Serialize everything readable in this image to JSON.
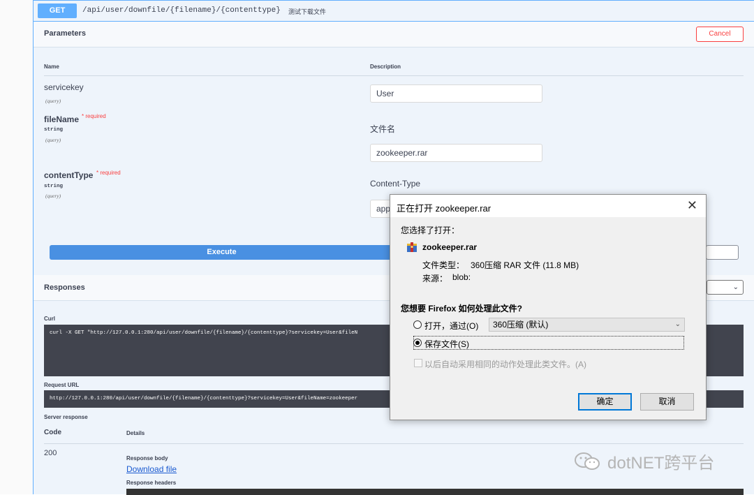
{
  "operation": {
    "method": "GET",
    "path": "/api/user/downfile/{filename}/{contenttype}",
    "summary": "测试下载文件"
  },
  "parameters": {
    "title": "Parameters",
    "cancel_label": "Cancel",
    "col_name": "Name",
    "col_description": "Description",
    "items": [
      {
        "name": "servicekey",
        "required": "",
        "type": "",
        "in": "(query)",
        "description": "",
        "value": "User"
      },
      {
        "name": "fileName",
        "required": "* required",
        "type": "string",
        "in": "(query)",
        "description": "文件名",
        "value": "zookeeper.rar"
      },
      {
        "name": "contentType",
        "required": "* required",
        "type": "string",
        "in": "(query)",
        "description": "Content-Type",
        "value": "app"
      }
    ],
    "execute_label": "Execute"
  },
  "responses": {
    "title": "Responses",
    "select_value": "⌄",
    "curl_label": "Curl",
    "curl_value": "curl -X GET \"http://127.0.0.1:280/api/user/downfile/{filename}/{contenttype}?servicekey=User&fileN",
    "request_url_label": "Request URL",
    "request_url_value": "http://127.0.0.1:280/api/user/downfile/{filename}/{contenttype}?servicekey=User&fileName=zookeeper",
    "server_response_label": "Server response",
    "col_code": "Code",
    "col_details": "Details",
    "code": "200",
    "response_body_label": "Response body",
    "download_link": "Download file",
    "response_headers_label": "Response headers"
  },
  "dialog": {
    "title": "正在打开 zookeeper.rar",
    "close_glyph": "✕",
    "intro": "您选择了打开：",
    "filename": "zookeeper.rar",
    "filetype_label": "文件类型：",
    "filetype_value": "360压缩 RAR 文件 (11.8 MB)",
    "source_label": "来源：",
    "source_value": "blob:",
    "question": "您想要 Firefox 如何处理此文件?",
    "open_with_label": "打开，通过(O)",
    "open_with_app": "360压缩 (默认)",
    "save_label": "保存文件(S)",
    "auto_label": "以后自动采用相同的动作处理此类文件。(A)",
    "ok_label": "确定",
    "cancel_label": "取消",
    "selected_option": "save"
  },
  "watermark": {
    "text": "dotNET跨平台"
  },
  "colors": {
    "get": "#61affe",
    "execute": "#4990e2",
    "cancel": "#f93e3e",
    "required": "#f93e3e",
    "link": "#1a5ad1"
  }
}
